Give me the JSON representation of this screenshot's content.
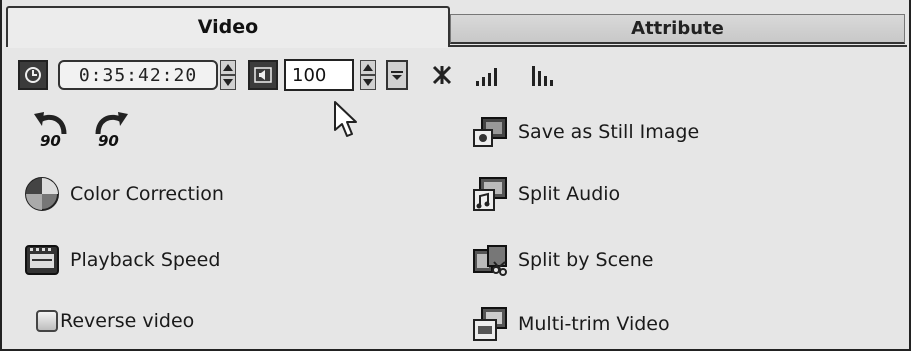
{
  "tabs": {
    "video": "Video",
    "attribute": "Attribute"
  },
  "toolbar": {
    "timecode": "0:35:42:20",
    "volume": "100"
  },
  "rotate": {
    "left_label": "90",
    "right_label": "90"
  },
  "left_items": {
    "color_correction": "Color Correction",
    "playback_speed": "Playback Speed",
    "reverse_video": "Reverse video"
  },
  "right_items": {
    "save_still": "Save as Still Image",
    "split_audio": "Split Audio",
    "split_scene": "Split by Scene",
    "multi_trim": "Multi-trim Video"
  },
  "icons": [
    "clock-icon",
    "speaker-icon",
    "fade-in-icon",
    "fade-out-icon",
    "normalize-icon",
    "rotate-left-icon",
    "rotate-right-icon",
    "color-wheel-icon",
    "film-speed-icon",
    "still-image-icon",
    "split-audio-icon",
    "split-scene-icon",
    "multi-trim-icon",
    "mouse-cursor-icon"
  ]
}
